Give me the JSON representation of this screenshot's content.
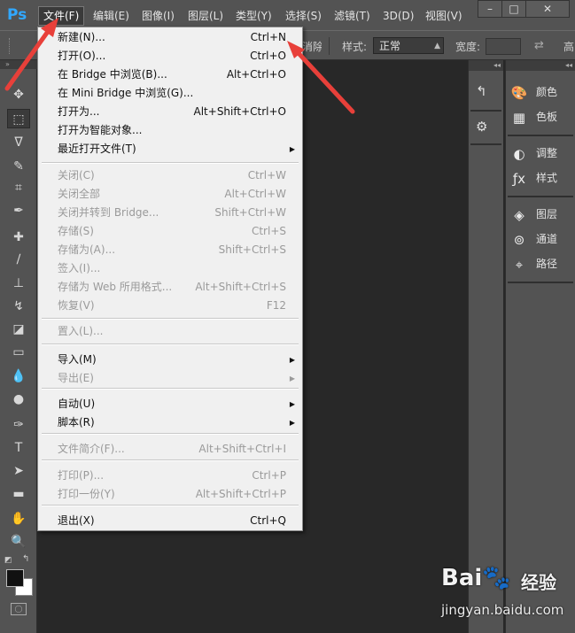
{
  "app": {
    "logo": "Ps"
  },
  "menubar": {
    "items": [
      "文件(F)",
      "编辑(E)",
      "图像(I)",
      "图层(L)",
      "类型(Y)",
      "选择(S)",
      "滤镜(T)",
      "3D(D)",
      "视图(V)"
    ],
    "active_index": 0
  },
  "window_controls": {
    "minimize": "–",
    "restore": "□",
    "close": "✕"
  },
  "options_bar": {
    "partial_label": "消除锯齿",
    "style_label": "样式:",
    "style_value": "正常",
    "width_label": "宽度:",
    "height_label_partial": "高"
  },
  "toolbar": {
    "tools": [
      "move",
      "rect-marquee",
      "lasso",
      "quick-select",
      "crop",
      "eyedropper",
      "spot-heal",
      "brush",
      "clone-stamp",
      "history-brush",
      "eraser",
      "gradient",
      "blur",
      "dodge",
      "pen",
      "type",
      "path-select",
      "rectangle",
      "hand",
      "zoom"
    ],
    "selected": "rect-marquee",
    "foreground_color": "#111111",
    "background_color": "#ffffff"
  },
  "file_menu": {
    "items": [
      {
        "label": "新建(N)...",
        "shortcut": "Ctrl+N",
        "enabled": true,
        "submenu": false
      },
      {
        "label": "打开(O)...",
        "shortcut": "Ctrl+O",
        "enabled": true,
        "submenu": false
      },
      {
        "label": "在 Bridge 中浏览(B)...",
        "shortcut": "Alt+Ctrl+O",
        "enabled": true,
        "submenu": false
      },
      {
        "label": "在 Mini Bridge 中浏览(G)...",
        "shortcut": "",
        "enabled": true,
        "submenu": false
      },
      {
        "label": "打开为...",
        "shortcut": "Alt+Shift+Ctrl+O",
        "enabled": true,
        "submenu": false
      },
      {
        "label": "打开为智能对象...",
        "shortcut": "",
        "enabled": true,
        "submenu": false
      },
      {
        "label": "最近打开文件(T)",
        "shortcut": "",
        "enabled": true,
        "submenu": true
      },
      {
        "label": "关闭(C)",
        "shortcut": "Ctrl+W",
        "enabled": false,
        "submenu": false
      },
      {
        "label": "关闭全部",
        "shortcut": "Alt+Ctrl+W",
        "enabled": false,
        "submenu": false
      },
      {
        "label": "关闭并转到 Bridge...",
        "shortcut": "Shift+Ctrl+W",
        "enabled": false,
        "submenu": false
      },
      {
        "label": "存储(S)",
        "shortcut": "Ctrl+S",
        "enabled": false,
        "submenu": false
      },
      {
        "label": "存储为(A)...",
        "shortcut": "Shift+Ctrl+S",
        "enabled": false,
        "submenu": false
      },
      {
        "label": "签入(I)...",
        "shortcut": "",
        "enabled": false,
        "submenu": false
      },
      {
        "label": "存储为 Web 所用格式...",
        "shortcut": "Alt+Shift+Ctrl+S",
        "enabled": false,
        "submenu": false
      },
      {
        "label": "恢复(V)",
        "shortcut": "F12",
        "enabled": false,
        "submenu": false
      },
      {
        "label": "置入(L)...",
        "shortcut": "",
        "enabled": false,
        "submenu": false
      },
      {
        "label": "导入(M)",
        "shortcut": "",
        "enabled": true,
        "submenu": true
      },
      {
        "label": "导出(E)",
        "shortcut": "",
        "enabled": false,
        "submenu": true
      },
      {
        "label": "自动(U)",
        "shortcut": "",
        "enabled": true,
        "submenu": true
      },
      {
        "label": "脚本(R)",
        "shortcut": "",
        "enabled": true,
        "submenu": true
      },
      {
        "label": "文件简介(F)...",
        "shortcut": "Alt+Shift+Ctrl+I",
        "enabled": false,
        "submenu": false
      },
      {
        "label": "打印(P)...",
        "shortcut": "Ctrl+P",
        "enabled": false,
        "submenu": false
      },
      {
        "label": "打印一份(Y)",
        "shortcut": "Alt+Shift+Ctrl+P",
        "enabled": false,
        "submenu": false
      },
      {
        "label": "退出(X)",
        "shortcut": "Ctrl+Q",
        "enabled": true,
        "submenu": false
      }
    ]
  },
  "panels": {
    "group1": [
      {
        "label": "颜色",
        "icon": "palette-icon"
      },
      {
        "label": "色板",
        "icon": "swatches-icon"
      }
    ],
    "group2": [
      {
        "label": "调整",
        "icon": "adjustments-icon"
      },
      {
        "label": "样式",
        "icon": "styles-icon"
      }
    ],
    "group3": [
      {
        "label": "图层",
        "icon": "layers-icon"
      },
      {
        "label": "通道",
        "icon": "channels-icon"
      },
      {
        "label": "路径",
        "icon": "paths-icon"
      }
    ]
  },
  "annotation": {
    "arrow_color": "#e8403a"
  },
  "watermark": {
    "logo": "Bai",
    "logo_suffix": "du",
    "text": "经验",
    "url": "jingyan.baidu.com"
  }
}
